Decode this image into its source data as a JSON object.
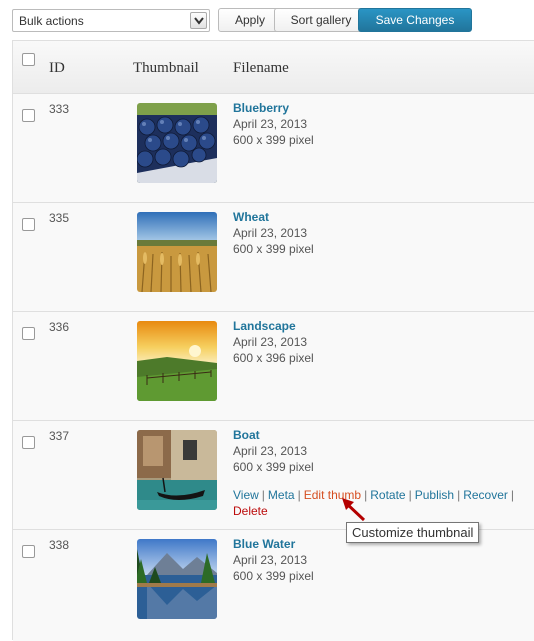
{
  "toolbar": {
    "bulk_actions": "Bulk actions",
    "apply_label": "Apply",
    "sort_label": "Sort gallery",
    "save_label": "Save Changes"
  },
  "table": {
    "columns": [
      "ID",
      "Thumbnail",
      "Filename"
    ],
    "rows": [
      {
        "id": "333",
        "name": "Blueberry",
        "date": "April 23, 2013",
        "size": "600 x 399 pixel"
      },
      {
        "id": "335",
        "name": "Wheat",
        "date": "April 23, 2013",
        "size": "600 x 399 pixel"
      },
      {
        "id": "336",
        "name": "Landscape",
        "date": "April 23, 2013",
        "size": "600 x 396 pixel"
      },
      {
        "id": "337",
        "name": "Boat",
        "date": "April 23, 2013",
        "size": "600 x 399 pixel"
      },
      {
        "id": "338",
        "name": "Blue Water",
        "date": "April 23, 2013",
        "size": "600 x 399 pixel"
      }
    ]
  },
  "row_actions": {
    "view": "View",
    "meta": "Meta",
    "edit_thumb": "Edit thumb",
    "rotate": "Rotate",
    "publish": "Publish",
    "recover": "Recover",
    "delete": "Delete",
    "separator": "|"
  },
  "tooltip": "Customize thumbnail",
  "colors": {
    "link": "#21759b",
    "edit_thumb": "#d54e21",
    "delete": "#bc0b0b",
    "primary_button": "#21759b",
    "arrow": "#b40000"
  }
}
